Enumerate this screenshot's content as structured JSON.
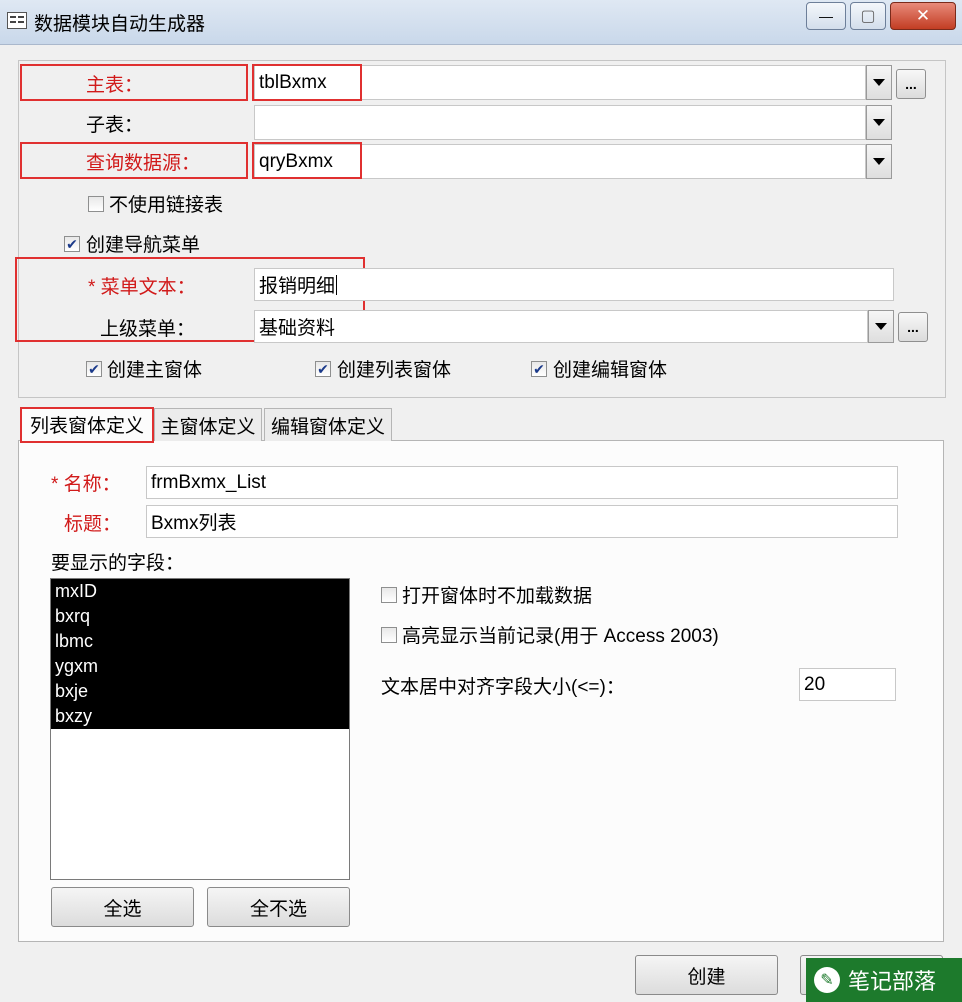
{
  "window": {
    "title": "数据模块自动生成器",
    "minimize_label": "—",
    "maximize_label": "▢",
    "close_label": "✕"
  },
  "top": {
    "main_table_label": "主表：",
    "main_table_value": "tblBxmx",
    "sub_table_label": "子表：",
    "sub_table_value": "",
    "query_label": "查询数据源：",
    "query_value": "qryBxmx",
    "no_link_table_label": "不使用链接表",
    "no_link_table_checked": false,
    "create_nav_menu_label": "创建导航菜单",
    "create_nav_menu_checked": true,
    "menu_text_label": "* 菜单文本：",
    "menu_text_value": "报销明细",
    "parent_menu_label": "上级菜单：",
    "parent_menu_value": "基础资料",
    "create_main_form_label": "创建主窗体",
    "create_list_form_label": "创建列表窗体",
    "create_edit_form_label": "创建编辑窗体",
    "dots_label": "..."
  },
  "tabs": [
    "列表窗体定义",
    "主窗体定义",
    "编辑窗体定义"
  ],
  "list_tab": {
    "name_label": "* 名称：",
    "name_value": "frmBxmx_List",
    "caption_label": "标题：",
    "caption_value": "Bxmx列表",
    "fields_label": "要显示的字段：",
    "fields": [
      "mxID",
      "bxrq",
      "lbmc",
      "ygxm",
      "bxje",
      "bxzy"
    ],
    "no_load_data_label": "打开窗体时不加载数据",
    "highlight_label": "高亮显示当前记录(用于 Access 2003)",
    "center_align_label": "文本居中对齐字段大小(<=)：",
    "center_align_value": "20",
    "select_all_label": "全选",
    "select_none_label": "全不选"
  },
  "footer": {
    "create_label": "创建",
    "watermark_text": "笔记部落"
  },
  "colors": {
    "accent_red": "#e03030",
    "label_red": "#d11a1a",
    "watermark_green": "#1d7a2c"
  }
}
